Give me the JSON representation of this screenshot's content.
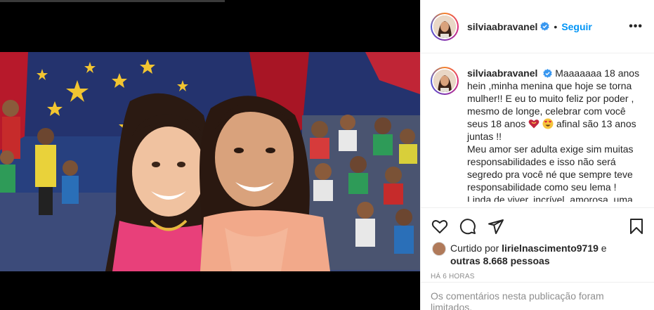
{
  "post": {
    "username": "silviaabravanel",
    "follow_label": "Seguir",
    "more_label": "•••",
    "caption_text": "Maaaaaaa 18 anos hein ,minha menina que hoje se torna mulher!! E eu to muito feliz por poder , mesmo de longe, celebrar com você seus 18 anos",
    "caption_text_after_emoji": "afinal são 13 anos juntas !!",
    "caption_paragraph_2": "Meu amor ser adulta exige sim muitas responsabilidades e isso não será segredo pra você né que sempre teve responsabilidade como seu lema !",
    "caption_paragraph_3": "Linda de viver, incrível, amorosa, uma",
    "liked_by_prefix": "Curtido por",
    "liked_by_user": "lirielnascimento9719",
    "liked_by_and": "e",
    "others_label": "outras 8.668 pessoas",
    "time_ago": "HÁ 6 HORAS",
    "comments_limited": "Os comentários nesta publicação foram limitados."
  },
  "icons": {
    "like": "heart-icon",
    "comment": "comment-icon",
    "share": "send-icon",
    "save": "bookmark-icon",
    "verified": "verified-badge-icon"
  },
  "colors": {
    "accent": "#0095f6",
    "text": "#262626",
    "muted": "#8e8e8e",
    "border": "#efefef"
  }
}
